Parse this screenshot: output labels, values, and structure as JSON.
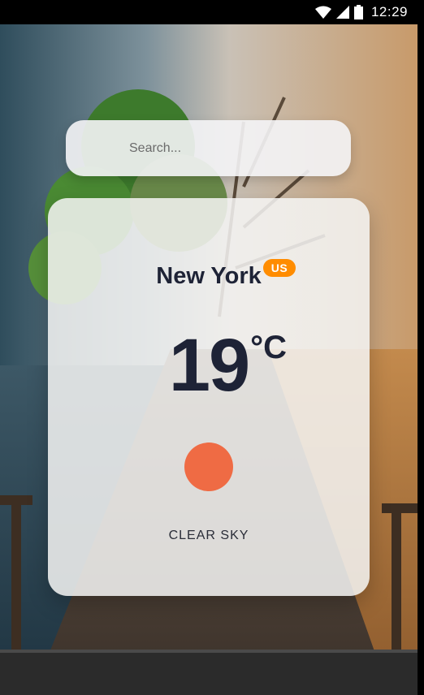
{
  "status_bar": {
    "time": "12:29",
    "icons": [
      "wifi-icon",
      "cellular-signal-icon",
      "battery-icon"
    ]
  },
  "search": {
    "placeholder": "Search...",
    "value": ""
  },
  "weather": {
    "city": "New York",
    "country": "US",
    "temperature": "19",
    "unit": "°C",
    "condition": "CLEAR SKY",
    "icon": "sun-icon"
  },
  "colors": {
    "text_dark": "#1e2336",
    "country_badge": "#ff8c00",
    "sun": "#ef6b44",
    "card_bg": "#f5f4f3"
  }
}
